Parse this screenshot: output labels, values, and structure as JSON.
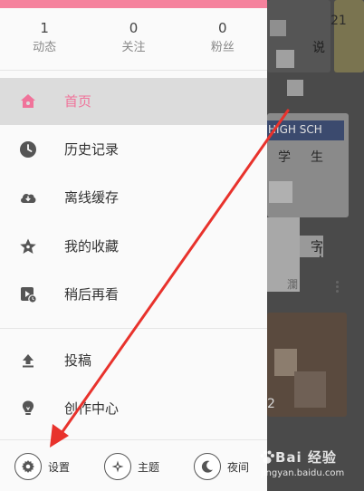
{
  "stats": [
    {
      "count": "1",
      "label": "动态"
    },
    {
      "count": "0",
      "label": "关注"
    },
    {
      "count": "0",
      "label": "粉丝"
    }
  ],
  "menu": [
    {
      "label": "首页",
      "icon": "home-icon",
      "active": true
    },
    {
      "label": "历史记录",
      "icon": "clock-icon"
    },
    {
      "label": "离线缓存",
      "icon": "cloud-download-icon"
    },
    {
      "label": "我的收藏",
      "icon": "star-icon"
    },
    {
      "label": "稍后再看",
      "icon": "watch-later-icon"
    },
    {
      "label": "投稿",
      "icon": "upload-icon"
    },
    {
      "label": "创作中心",
      "icon": "lightbulb-icon"
    }
  ],
  "bottom": {
    "settings_label": "设置",
    "theme_label": "主题",
    "night_label": "夜间"
  },
  "content": {
    "texts": [
      "21",
      "说",
      "HIGH SCH",
      "学",
      "生",
      "字",
      "!",
      "瀾",
      "2"
    ]
  },
  "watermark": {
    "main": "Bai 经验",
    "sub": "jingyan.baidu.com"
  },
  "colors": {
    "accent": "#f0739a",
    "top_bar": "#f5829d",
    "annotation_arrow": "#e8322c"
  }
}
